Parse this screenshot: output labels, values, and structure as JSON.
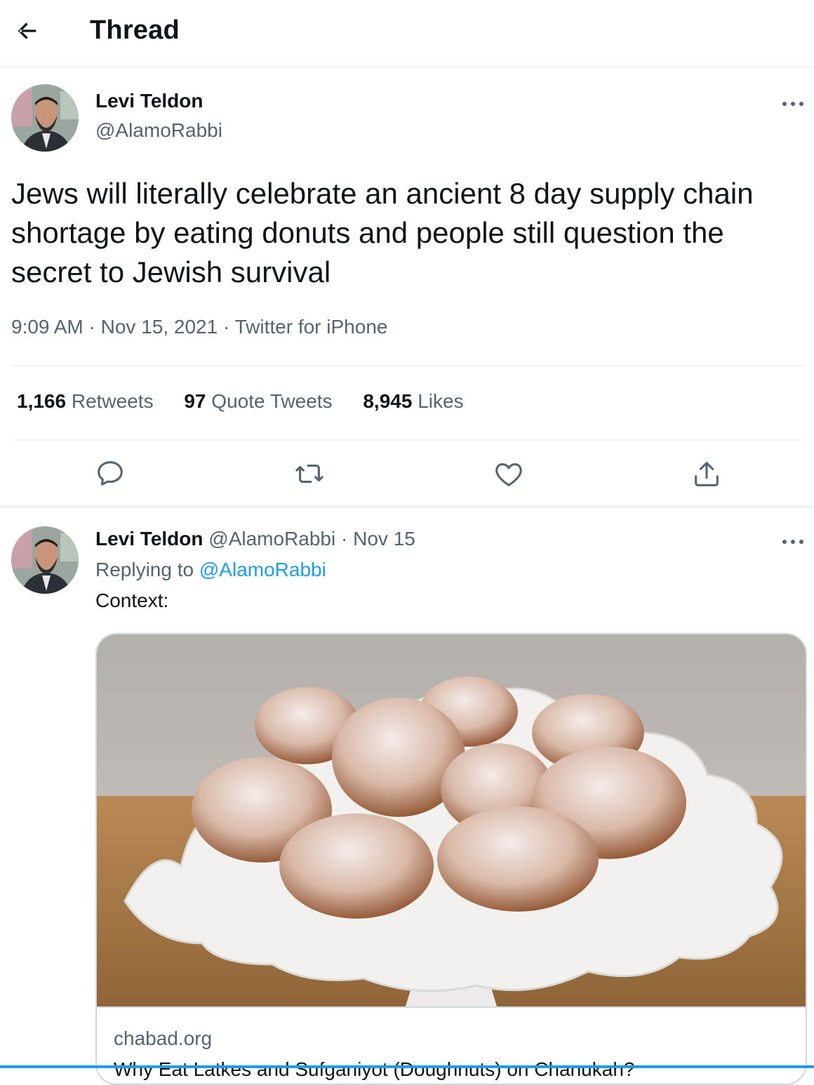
{
  "header": {
    "title": "Thread",
    "back_icon": "arrow-left-icon"
  },
  "main_tweet": {
    "author_name": "Levi Teldon",
    "author_handle": "@AlamoRabbi",
    "text": "Jews will literally celebrate an ancient 8 day supply chain shortage by eating donuts and people still question the secret to Jewish survival",
    "time": "9:09 AM",
    "date": "Nov 15, 2021",
    "source": "Twitter for iPhone",
    "separator": "·",
    "stats": {
      "retweets_count": "1,166",
      "retweets_label": "Retweets",
      "quotes_count": "97",
      "quotes_label": "Quote Tweets",
      "likes_count": "8,945",
      "likes_label": "Likes"
    }
  },
  "reply": {
    "author_name": "Levi Teldon",
    "author_handle": "@AlamoRabbi",
    "separator": "·",
    "date": "Nov 15",
    "replying_label": "Replying to",
    "replying_handle": "@AlamoRabbi",
    "text": "Context:",
    "card": {
      "domain": "chabad.org",
      "title": "Why Eat Latkes and Sufganiyot (Doughnuts) on Chanukah?"
    }
  },
  "colors": {
    "accent": "#1d9bf0",
    "muted": "#536471",
    "text": "#0f1419",
    "border": "#eff3f4"
  }
}
